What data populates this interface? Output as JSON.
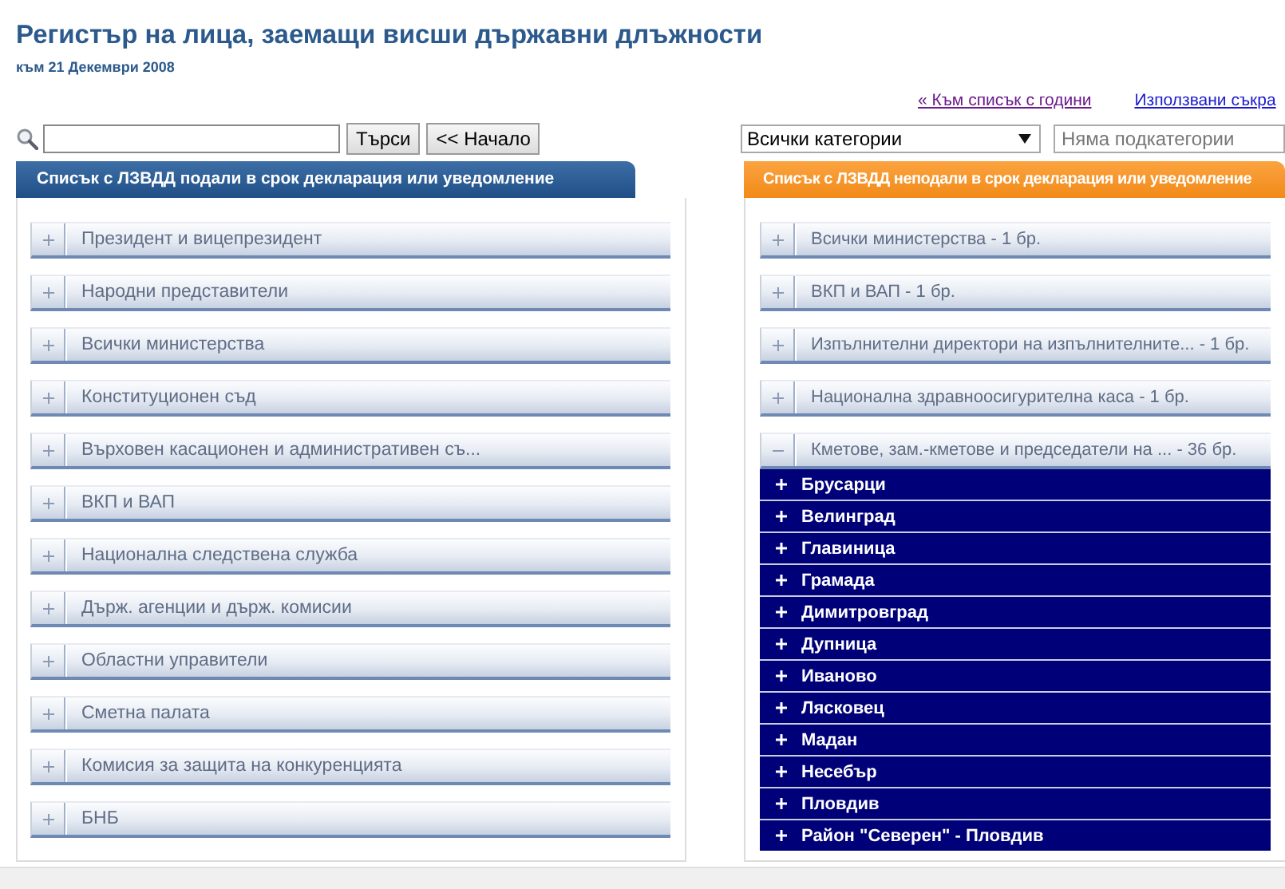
{
  "page": {
    "title": "Регистър на лица, заемащи висши държавни длъжности",
    "date": "към 21 Декември 2008"
  },
  "links": [
    {
      "label": "« Към списък с години",
      "visited": true
    },
    {
      "label": "Използвани съкра",
      "visited": false
    }
  ],
  "search": {
    "buttons": [
      "Търси",
      "<< Начало"
    ]
  },
  "filters": {
    "category": "Всички категории",
    "subcategory_placeholder": "Няма подкатегории"
  },
  "panels": [
    {
      "title": "Списък с ЛЗВДД подали в срок декларация или уведомление",
      "kind": "filed",
      "items": [
        {
          "label": "Президент и вицепрезидент",
          "expanded": false
        },
        {
          "label": "Народни представители",
          "expanded": false
        },
        {
          "label": "Всички министерства",
          "expanded": false
        },
        {
          "label": "Конституционен съд",
          "expanded": false
        },
        {
          "label": "Върховен касационен и административен съ...",
          "expanded": false
        },
        {
          "label": "ВКП и ВАП",
          "expanded": false
        },
        {
          "label": "Национална следствена служба",
          "expanded": false
        },
        {
          "label": "Държ. агенции и държ. комисии",
          "expanded": false
        },
        {
          "label": "Областни управители",
          "expanded": false
        },
        {
          "label": "Сметна палата",
          "expanded": false
        },
        {
          "label": "Комисия за защита на конкуренцията",
          "expanded": false
        },
        {
          "label": "БНБ",
          "expanded": false
        }
      ]
    },
    {
      "title": "Списък с ЛЗВДД неподали в срок декларация или уведомление",
      "kind": "unfiled",
      "items": [
        {
          "label": "Всички министерства - 1 бр.",
          "expanded": false
        },
        {
          "label": "ВКП и ВАП - 1 бр.",
          "expanded": false
        },
        {
          "label": "Изпълнителни директори на изпълнителните... - 1 бр.",
          "expanded": false
        },
        {
          "label": "Национална здравноосигурителна каса - 1 бр.",
          "expanded": false
        },
        {
          "label": "Кметове, зам.-кметове и председатели на ... - 36 бр.",
          "expanded": true,
          "children": [
            {
              "label": "Брусарци"
            },
            {
              "label": "Велинград"
            },
            {
              "label": "Главиница"
            },
            {
              "label": "Грамада"
            },
            {
              "label": "Димитровград"
            },
            {
              "label": "Дупница"
            },
            {
              "label": "Иваново"
            },
            {
              "label": "Лясковец"
            },
            {
              "label": "Мадан"
            },
            {
              "label": "Несебър"
            },
            {
              "label": "Пловдив"
            },
            {
              "label": "Район \"Северен\" - Пловдив"
            }
          ]
        }
      ]
    }
  ]
}
